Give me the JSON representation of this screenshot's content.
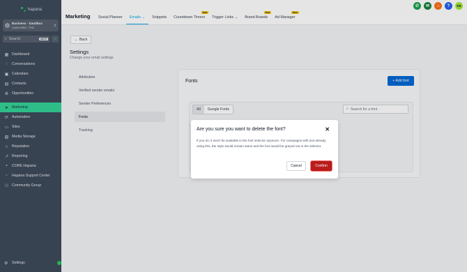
{
  "sidebar": {
    "logo_text": "hapana",
    "account": {
      "name": "Business - Sandbox",
      "location": "Launceston, TAS"
    },
    "search": {
      "placeholder": "Search",
      "shortcut": "ctrl K"
    },
    "items": [
      {
        "label": "Dashboard",
        "icon": "grid-icon"
      },
      {
        "label": "Conversations",
        "icon": "chat-icon"
      },
      {
        "label": "Calendars",
        "icon": "calendar-icon"
      },
      {
        "label": "Contacts",
        "icon": "contacts-icon"
      },
      {
        "label": "Opportunities",
        "icon": "opportunities-icon"
      },
      {
        "label": "Marketing",
        "icon": "send-icon",
        "active": true
      },
      {
        "label": "Automation",
        "icon": "automation-icon"
      },
      {
        "label": "Sites",
        "icon": "sites-icon"
      },
      {
        "label": "Media Storage",
        "icon": "media-icon"
      },
      {
        "label": "Reputation",
        "icon": "star-icon"
      },
      {
        "label": "Reporting",
        "icon": "chart-icon"
      },
      {
        "label": "CORE Hapana",
        "icon": "core-icon"
      },
      {
        "label": "Hapana Support Center",
        "icon": "support-icon"
      },
      {
        "label": "Community Group",
        "icon": "community-icon"
      }
    ],
    "settings_label": "Settings"
  },
  "topbar": {
    "title": "Marketing",
    "tabs": [
      {
        "label": "Social Planner",
        "active": false,
        "badge": "",
        "dropdown": false
      },
      {
        "label": "Emails",
        "active": true,
        "badge": "",
        "dropdown": true
      },
      {
        "label": "Snippets",
        "active": false,
        "badge": "",
        "dropdown": false
      },
      {
        "label": "Countdown Timers",
        "active": false,
        "badge": "New",
        "dropdown": false
      },
      {
        "label": "Trigger Links",
        "active": false,
        "badge": "",
        "dropdown": true
      },
      {
        "label": "Brand Boards",
        "active": false,
        "badge": "New",
        "dropdown": false
      },
      {
        "label": "Ad Manager",
        "active": false,
        "badge": "New",
        "dropdown": false
      }
    ],
    "icons": [
      {
        "name": "phone-icon",
        "glyph": "✆",
        "color": "#16a34a"
      },
      {
        "name": "megaphone-icon",
        "glyph": "✉",
        "color": "#15803d"
      },
      {
        "name": "bell-icon",
        "glyph": "♪",
        "color": "#f97316"
      },
      {
        "name": "help-icon",
        "glyph": "?",
        "color": "#2563eb"
      },
      {
        "name": "avatar",
        "glyph": "RE",
        "color": "#a3e635"
      }
    ]
  },
  "settings": {
    "back_label": "Back",
    "title": "Settings",
    "subtitle": "Change your email settings",
    "nav": [
      {
        "label": "Attribution",
        "active": false
      },
      {
        "label": "Verified sender emails",
        "active": false
      },
      {
        "label": "Sender Preferences",
        "active": false
      },
      {
        "label": "Fonts",
        "active": true
      },
      {
        "label": "Tracking",
        "active": false
      }
    ]
  },
  "fonts": {
    "title": "Fonts",
    "add_label": "+ Add font",
    "filters": [
      "All",
      "Google Fonts"
    ],
    "active_filter": "All",
    "search_placeholder": "Search for a font"
  },
  "modal": {
    "title": "Are you sure you want to delete the font?",
    "body": "If you do, it won't be available in the font selector anymore. For campaigns with text already using this, the style would remain same and the font would be greyed out in the selector.",
    "cancel_label": "Cancel",
    "confirm_label": "Confirm"
  },
  "colors": {
    "sidebar_bg": "#3f4b5c",
    "active_nav": "#34d399",
    "primary": "#0369d4",
    "confirm_bg": "#b91c1c"
  }
}
